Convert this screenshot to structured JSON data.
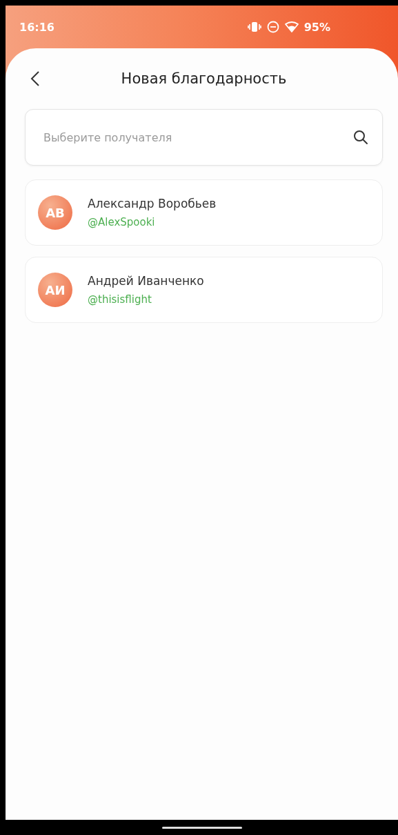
{
  "status_bar": {
    "time": "16:16",
    "battery": "95%"
  },
  "header": {
    "title": "Новая благодарность"
  },
  "search": {
    "placeholder": "Выберите получателя"
  },
  "recipients": [
    {
      "initials": "АВ",
      "name": "Александр Воробьев",
      "handle": "@AlexSpooki"
    },
    {
      "initials": "АИ",
      "name": "Андрей Иванченко",
      "handle": "@thisisflight"
    }
  ]
}
